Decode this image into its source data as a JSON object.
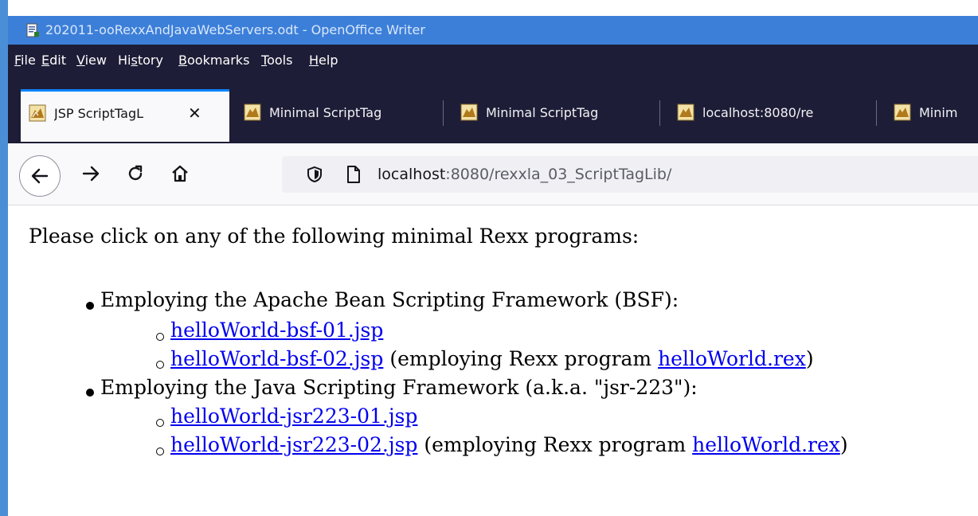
{
  "window": {
    "title": "202011-ooRexxAndJavaWebServers.odt - OpenOffice Writer"
  },
  "menu": {
    "items": [
      {
        "pre": "",
        "key": "F",
        "post": "ile"
      },
      {
        "pre": "",
        "key": "E",
        "post": "dit"
      },
      {
        "pre": "",
        "key": "V",
        "post": "iew"
      },
      {
        "pre": "Hi",
        "key": "s",
        "post": "tory"
      },
      {
        "pre": "",
        "key": "B",
        "post": "ookmarks"
      },
      {
        "pre": "",
        "key": "T",
        "post": "ools"
      },
      {
        "pre": "",
        "key": "H",
        "post": "elp"
      }
    ]
  },
  "tabs": [
    {
      "label": "JSP ScriptTagL",
      "active": true,
      "close": "✕"
    },
    {
      "label": "Minimal ScriptTag"
    },
    {
      "label": "Minimal ScriptTag"
    },
    {
      "label": "localhost:8080/re"
    },
    {
      "label": "Minim"
    }
  ],
  "urlbar": {
    "host": "localhost",
    "rest": ":8080/rexxla_03_ScriptTagLib/"
  },
  "page": {
    "intro": "Please click on any of the following minimal Rexx programs:",
    "section1": "Employing the Apache Bean Scripting Framework (BSF):",
    "bsf01": "helloWorld-bsf-01.jsp",
    "bsf02": "helloWorld-bsf-02.jsp",
    "employing": " (employing Rexx program ",
    "rexlink": "helloWorld.rex",
    "close_paren": ")",
    "section2": "Employing the Java Scripting Framework (a.k.a. \"jsr-223\"):",
    "jsr01": "helloWorld-jsr223-01.jsp",
    "jsr02": "helloWorld-jsr223-02.jsp"
  },
  "colors": {
    "titlebar": "#3c7fd9",
    "menubar": "#1e1d37",
    "link": "#0000ee",
    "active_tab_accent": "#0a84ff"
  }
}
